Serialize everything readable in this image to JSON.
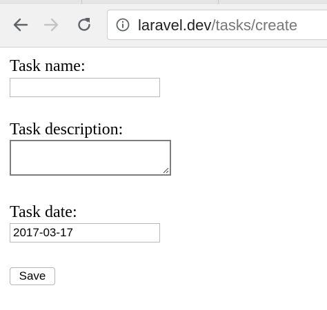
{
  "browser": {
    "url_host": "laravel.dev",
    "url_path": "/tasks/create",
    "icons": {
      "back": "back-arrow-icon",
      "forward": "forward-arrow-icon",
      "reload": "reload-icon",
      "site_info": "info-icon"
    }
  },
  "form": {
    "name_label": "Task name:",
    "name_value": "",
    "description_label": "Task description:",
    "description_value": "",
    "date_label": "Task date:",
    "date_value": "2017-03-17",
    "save_label": "Save"
  }
}
